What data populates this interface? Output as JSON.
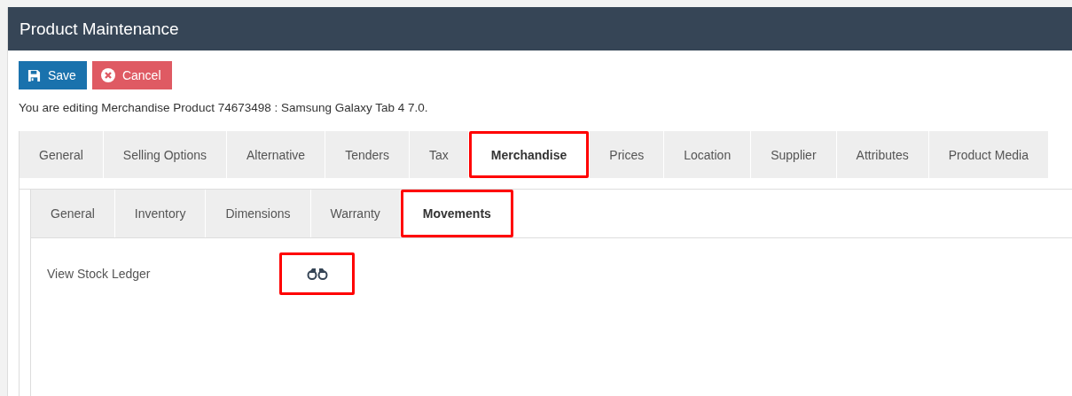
{
  "window": {
    "title": "Product Maintenance"
  },
  "toolbar": [
    {
      "kind": "save",
      "label": "Save"
    },
    {
      "kind": "cancel",
      "label": "Cancel"
    }
  ],
  "info": "You are editing Merchandise Product 74673498 : Samsung Galaxy Tab 4 7.0.",
  "tabs": [
    {
      "label": "General",
      "selected": false,
      "highlighted": false
    },
    {
      "label": "Selling Options",
      "selected": false,
      "highlighted": false
    },
    {
      "label": "Alternative",
      "selected": false,
      "highlighted": false
    },
    {
      "label": "Tenders",
      "selected": false,
      "highlighted": false
    },
    {
      "label": "Tax",
      "selected": false,
      "highlighted": false
    },
    {
      "label": "Merchandise",
      "selected": true,
      "highlighted": true
    },
    {
      "label": "Prices",
      "selected": false,
      "highlighted": false
    },
    {
      "label": "Location",
      "selected": false,
      "highlighted": false
    },
    {
      "label": "Supplier",
      "selected": false,
      "highlighted": false
    },
    {
      "label": "Attributes",
      "selected": false,
      "highlighted": false
    },
    {
      "label": "Product Media",
      "selected": false,
      "highlighted": false
    }
  ],
  "subtabs": [
    {
      "label": "General",
      "selected": false,
      "highlighted": false
    },
    {
      "label": "Inventory",
      "selected": false,
      "highlighted": false
    },
    {
      "label": "Dimensions",
      "selected": false,
      "highlighted": false
    },
    {
      "label": "Warranty",
      "selected": false,
      "highlighted": false
    },
    {
      "label": "Movements",
      "selected": true,
      "highlighted": true
    }
  ],
  "fields": [
    {
      "label": "View Stock Ledger",
      "highlighted": true
    }
  ]
}
